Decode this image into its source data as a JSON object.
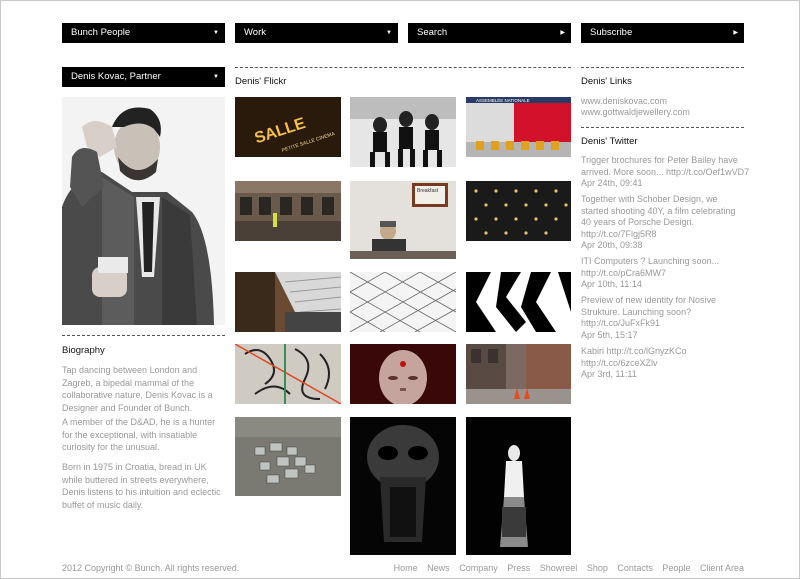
{
  "nav": {
    "people": "Bunch People",
    "work": "Work",
    "search": "Search",
    "subscribe": "Subscribe"
  },
  "person": {
    "selected": "Denis Kovac, Partner"
  },
  "biography": {
    "title": "Biography",
    "p1": "Tap dancing between London and Zagreb, a bipedal mammal of the collaborative nature, Denis Kovac is a Designer and Founder of Bunch.",
    "p2": "A member of the D&AD, he is a hunter for the exceptional, with insatiable curiosity for the unusual.",
    "p3": "Born in 1975 in Croatia, bread in UK while buttered in streets everywhere, Denis listens to his intuition and eclectic buffet of music daily."
  },
  "flickr": {
    "title": "Denis' Flickr"
  },
  "links": {
    "title": "Denis' Links",
    "items": [
      "www.deniskovac.com",
      "www.gottwaldjewellery.com"
    ]
  },
  "twitter": {
    "title": "Denis' Twitter",
    "tweets": [
      {
        "text1": "Trigger brochures for Peter Bailey have",
        "text2": "arrived. More soon... http://t.co/Oef1wVD7",
        "date": "Apr 24th, 09:41"
      },
      {
        "text1": "Together with Schober Design, we",
        "text2": "started shooting 40Y, a film celebrating",
        "text3": "40 years of Porsche Design.",
        "text4": "http://t.co/7Flgj5R8",
        "date": "Apr 20th, 09:38"
      },
      {
        "text1": "ITI Computers ? Launching soon...",
        "text2": "http://t.co/pCra6MW7",
        "date": "Apr 10th, 11:14"
      },
      {
        "text1": "Preview of new identity for Nosive",
        "text2": "Strukture. Launching soon?",
        "text3": "http://t.co/JuFxFk91",
        "date": "Apr 5th, 15:17"
      },
      {
        "text1": "Kabiri http://t.co/lGnyzKCo",
        "text2": "http://t.co/6zceXZlv",
        "date": "Apr 3rd, 11:11"
      }
    ]
  },
  "footer": {
    "copyright": "2012 Copyright © Bunch. All rights reserved.",
    "nav": [
      "Home",
      "News",
      "Company",
      "Press",
      "Showreel",
      "Shop",
      "Contacts",
      "People",
      "Client Area"
    ]
  },
  "photo_texts": {
    "sign_sale": "SALLE",
    "sign_cinema": "PETITE SALLE CINEMA",
    "sign_assemblee": "ASSEMBLÉE NATIONALE",
    "sign_breakfast": "Breakfast"
  }
}
